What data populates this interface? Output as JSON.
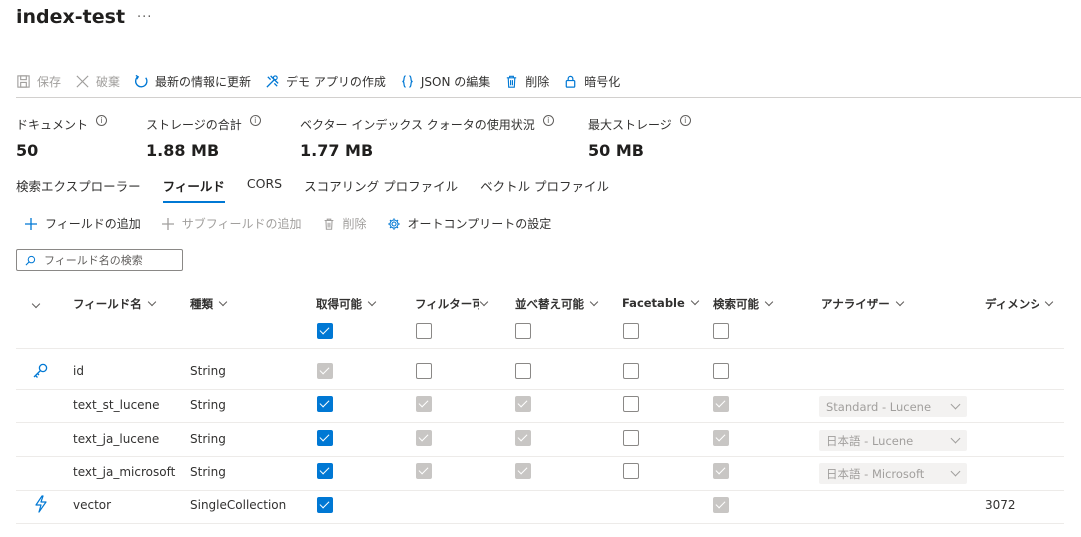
{
  "header": {
    "title": "index-test",
    "more": "···"
  },
  "toolbar": {
    "save": "保存",
    "discard": "破棄",
    "refresh": "最新の情報に更新",
    "demo_app": "デモ アプリの作成",
    "edit_json": "JSON の編集",
    "delete": "削除",
    "encryption": "暗号化"
  },
  "stats": {
    "documents": {
      "label": "ドキュメント",
      "value": "50"
    },
    "total_storage": {
      "label": "ストレージの合計",
      "value": "1.88 MB"
    },
    "vector_quota": {
      "label": "ベクター インデックス クォータの使用状況",
      "value": "1.77 MB"
    },
    "max_storage": {
      "label": "最大ストレージ",
      "value": "50 MB"
    }
  },
  "tabs": [
    "検索エクスプローラー",
    "フィールド",
    "CORS",
    "スコアリング プロファイル",
    "ベクトル プロファイル"
  ],
  "active_tab": "フィールド",
  "fields_commands": {
    "add_field": "フィールドの追加",
    "add_subfield": "サブフィールドの追加",
    "delete": "削除",
    "autocomplete": "オートコンプリートの設定"
  },
  "search": {
    "placeholder": "フィールド名の検索"
  },
  "columns": {
    "name": "フィールド名",
    "type": "種類",
    "retrievable": "取得可能",
    "filterable": "フィルター可",
    "sortable": "並べ替え可能",
    "facetable": "Facetable",
    "searchable": "検索可能",
    "analyzer": "アナライザー",
    "dimensions": "ディメンシ"
  },
  "header_checkboxes": {
    "retrievable": true,
    "filterable": false,
    "sortable": false,
    "facetable": false,
    "searchable": false
  },
  "rows": [
    {
      "icon": "key-icon",
      "name": "id",
      "type": "String",
      "retrievable": "grey",
      "filterable": "empty",
      "sortable": "empty",
      "facetable": "empty",
      "searchable": "empty",
      "analyzer": "",
      "dimensions": ""
    },
    {
      "icon": "",
      "name": "text_st_lucene",
      "type": "String",
      "retrievable": "checked",
      "filterable": "grey",
      "sortable": "grey",
      "facetable": "empty",
      "searchable": "grey",
      "analyzer": "Standard - Lucene",
      "dimensions": ""
    },
    {
      "icon": "",
      "name": "text_ja_lucene",
      "type": "String",
      "retrievable": "checked",
      "filterable": "grey",
      "sortable": "grey",
      "facetable": "empty",
      "searchable": "grey",
      "analyzer": "日本語 - Lucene",
      "dimensions": ""
    },
    {
      "icon": "",
      "name": "text_ja_microsoft",
      "type": "String",
      "retrievable": "checked",
      "filterable": "grey",
      "sortable": "grey",
      "facetable": "empty",
      "searchable": "grey",
      "analyzer": "日本語 - Microsoft",
      "dimensions": ""
    },
    {
      "icon": "lightning-icon",
      "name": "vector",
      "type": "SingleCollection",
      "retrievable": "checked",
      "filterable": "",
      "sortable": "",
      "facetable": "",
      "searchable": "grey",
      "analyzer": "",
      "dimensions": "3072"
    }
  ],
  "colors": {
    "accent": "#0078d4",
    "disabled_check": "#c8c6c4"
  }
}
